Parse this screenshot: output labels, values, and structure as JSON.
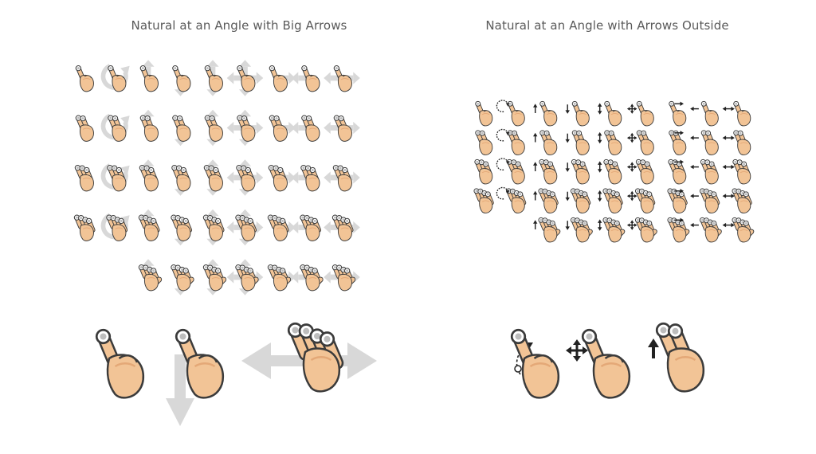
{
  "titles": {
    "left": "Natural at an Angle with Big Arrows",
    "right": "Natural at an Angle with Arrows Outside"
  },
  "colors": {
    "skin": "#f2c496",
    "skin_shade": "#e4a877",
    "outline": "#3b3b3b",
    "big_arrow": "#d8d8d8",
    "small_arrow": "#222222"
  },
  "left_grid": [
    [
      "one-tap",
      "one-rotate",
      "one-up",
      "one-down",
      "one-updown",
      "one-cross",
      "one-right",
      "one-left",
      "one-leftright"
    ],
    [
      "two-tap",
      "two-rotate",
      "two-up",
      "two-down",
      "two-updown",
      "two-cross",
      "two-right",
      "two-left",
      "two-leftright"
    ],
    [
      "three-tap",
      "three-rotate",
      "three-up",
      "three-down",
      "three-updown",
      "three-cross",
      "three-right",
      "three-left",
      "three-leftright"
    ],
    [
      "four-tap",
      "four-rotate",
      "four-up",
      "four-down",
      "four-updown",
      "four-cross",
      "four-right",
      "four-left",
      "four-leftright"
    ],
    [
      "",
      "",
      "five-up",
      "five-down",
      "five-updown",
      "five-cross",
      "five-right",
      "five-left",
      "five-leftright"
    ]
  ],
  "right_grid": [
    [
      "one-tap",
      "one-rotate",
      "one-up",
      "one-down",
      "one-updown",
      "one-cross",
      "one-right",
      "one-left",
      "one-leftright"
    ],
    [
      "two-tap",
      "two-rotate",
      "two-up",
      "two-down",
      "two-updown",
      "two-cross",
      "two-right",
      "two-left",
      "two-leftright"
    ],
    [
      "three-tap",
      "three-rotate",
      "three-up",
      "three-down",
      "three-updown",
      "three-cross",
      "three-right",
      "three-left",
      "three-leftright"
    ],
    [
      "four-tap",
      "four-rotate",
      "four-up",
      "four-down",
      "four-updown",
      "four-cross",
      "four-right",
      "four-left",
      "four-leftright"
    ],
    [
      "",
      "",
      "five-up",
      "five-down",
      "five-updown",
      "five-cross",
      "five-right",
      "five-left",
      "five-leftright"
    ]
  ],
  "large_left": [
    "one-tap",
    "one-down",
    "four-leftright"
  ],
  "large_right": [
    "one-rotate",
    "one-cross",
    "two-up"
  ]
}
